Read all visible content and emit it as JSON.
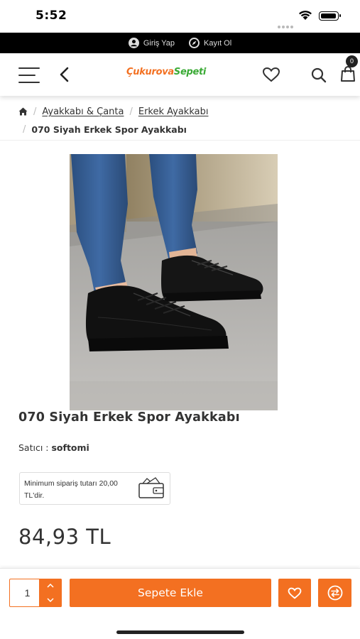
{
  "status_bar": {
    "time": "5:52"
  },
  "auth": {
    "login_label": "Giriş Yap",
    "register_label": "Kayıt Ol"
  },
  "header": {
    "logo_part1": "Çukurova",
    "logo_part2": "Sepeti",
    "cart_count": "0"
  },
  "breadcrumb": {
    "items": [
      "Ayakkabı & Çanta",
      "Erkek Ayakkabı"
    ],
    "current": "070 Siyah Erkek Spor Ayakkabı"
  },
  "product": {
    "title": "070 Siyah Erkek Spor Ayakkabı",
    "seller_label": "Satıcı :",
    "seller_name": "softomi",
    "min_order_text": "Minimum sipariş tutarı 20,00 TL'dir.",
    "price": "84,93 TL"
  },
  "actions": {
    "quantity": "1",
    "add_to_cart_label": "Sepete Ekle"
  },
  "colors": {
    "accent": "#f37021",
    "logo_green": "#3aaa35",
    "auth_bar": "#000000"
  },
  "icons": [
    "home-icon",
    "user-icon",
    "compass-icon",
    "menu-icon",
    "back-icon",
    "heart-icon",
    "search-icon",
    "shopping-bag-icon",
    "wallet-icon",
    "chevron-up-icon",
    "chevron-down-icon",
    "compare-icon"
  ]
}
